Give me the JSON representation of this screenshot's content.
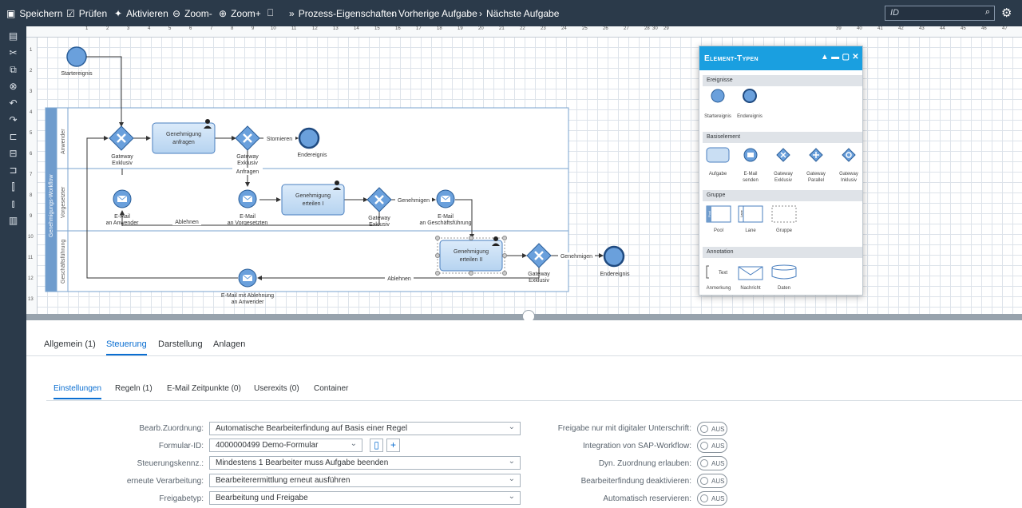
{
  "toolbar": {
    "save": "Speichern",
    "check": "Prüfen",
    "activate": "Aktivieren",
    "zoom_out": "Zoom-",
    "zoom_in": "Zoom+",
    "process_props": "Prozess-Eigenschaften",
    "prev_task": "Vorherige Aufgabe",
    "next_task": "Nächste Aufgabe",
    "search_placeholder": "ID"
  },
  "ruler_ticks": [
    "1",
    "2",
    "3",
    "4",
    "5",
    "6",
    "7",
    "8",
    "9",
    "10",
    "11",
    "12",
    "13",
    "14",
    "15",
    "16",
    "17",
    "18",
    "19",
    "20",
    "21",
    "22",
    "23",
    "24",
    "25",
    "26",
    "27",
    "28",
    "29",
    "30",
    "39",
    "40",
    "41",
    "42",
    "43",
    "44",
    "45",
    "46",
    "47"
  ],
  "vruler_ticks": [
    "1",
    "2",
    "3",
    "4",
    "5",
    "6",
    "7",
    "8",
    "9",
    "10",
    "11",
    "12",
    "13"
  ],
  "diagram": {
    "start_event": "Startereignis",
    "pool": "Genehmigungs-Workflow",
    "lanes": [
      "Anwender",
      "Vorgesetzter",
      "Geschäftsführung"
    ],
    "task_request": [
      "Genehmigung",
      "anfragen"
    ],
    "task_approve1": [
      "Genehmigung",
      "erteilen I"
    ],
    "task_approve2": [
      "Genehmigung",
      "erteilen II"
    ],
    "gateway1": [
      "Gateway",
      "Exklusiv"
    ],
    "gateway2": [
      "Gateway",
      "Exklusiv"
    ],
    "gateway3": [
      "Gateway",
      "Exklusiv"
    ],
    "gateway4": [
      "Gateway",
      "Exklusiv"
    ],
    "end_event1": "Endereignis",
    "end_event2": "Endereignis",
    "flow_cancel": "Stornieren",
    "flow_request": "Anfragen",
    "flow_reject1": "Ablehnen",
    "flow_approve1": "Genehmigen",
    "flow_approve2": "Genehmigen",
    "flow_reject2": "Ablehnen",
    "email_user": [
      "E-Mail",
      "an Anwender"
    ],
    "email_manager": [
      "E-Mail",
      "an Vorgesetzten"
    ],
    "email_ceo": [
      "E-Mail",
      "an Geschäftsführung"
    ],
    "email_reject": [
      "E-Mail mit Ablehnung",
      "an Anwender"
    ]
  },
  "palette": {
    "title": "Element-Typen",
    "sections": {
      "events": "Ereignisse",
      "basic": "Basiselement",
      "group": "Gruppe",
      "annotation": "Annotation"
    },
    "events": [
      "Startereignis",
      "Endereignis"
    ],
    "basic": [
      [
        "Aufgabe",
        ""
      ],
      [
        "E-Mail",
        "senden"
      ],
      [
        "Gateway",
        "Exklusiv"
      ],
      [
        "Gateway",
        "Parallel"
      ],
      [
        "Gateway",
        "Inklusiv"
      ]
    ],
    "group": [
      "Pool",
      "Lane",
      "Gruppe"
    ],
    "group_inner": [
      "Pool",
      "Lane"
    ],
    "annotation": [
      "Anmerkung",
      "Nachricht",
      "Daten"
    ],
    "annotation_text": "Text"
  },
  "tabs": [
    "Allgemein (1)",
    "Steuerung",
    "Darstellung",
    "Anlagen"
  ],
  "subtabs": [
    "Einstellungen",
    "Regeln (1)",
    "E-Mail Zeitpunkte (0)",
    "Userexits (0)",
    "Container"
  ],
  "form": {
    "assignment_label": "Bearb.Zuordnung:",
    "assignment_value": "Automatische Bearbeiterfindung auf Basis einer Regel",
    "form_id_label": "Formular-ID:",
    "form_id_value": "4000000499 Demo-Formular",
    "control_label": "Steuerungskennz.:",
    "control_value": "Mindestens 1 Bearbeiter muss Aufgabe beenden",
    "reprocess_label": "erneute Verarbeitung:",
    "reprocess_value": "Bearbeiterermittlung erneut ausführen",
    "release_label": "Freigabetyp:",
    "release_value": "Bearbeitung und Freigabe"
  },
  "toggles": {
    "signature": "Freigabe nur mit digitaler Unterschrift:",
    "sap_workflow": "Integration von SAP-Workflow:",
    "dyn_assignment": "Dyn. Zuordnung erlauben:",
    "deactivate": "Bearbeiterfindung deaktivieren:",
    "auto_reserve": "Automatisch reservieren:",
    "off": "AUS"
  }
}
